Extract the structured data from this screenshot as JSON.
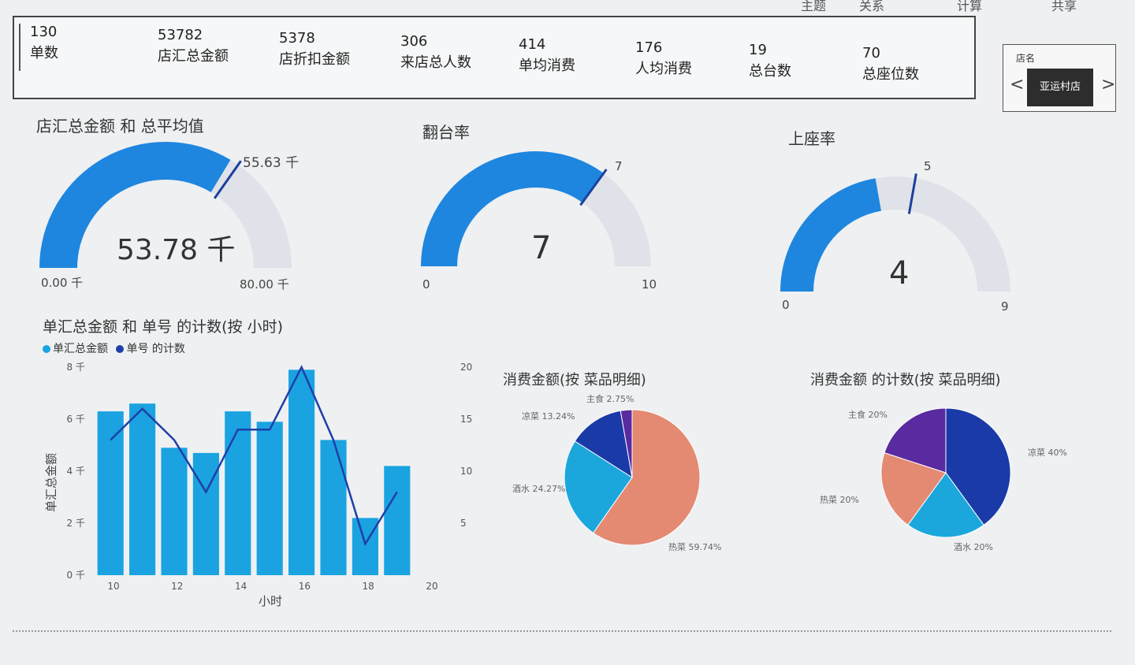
{
  "menu": [
    "主题",
    "关系",
    "计算",
    "共享"
  ],
  "kpis": [
    {
      "value": "130",
      "label": "单数"
    },
    {
      "value": "53782",
      "label": "店汇总金额"
    },
    {
      "value": "5378",
      "label": "店折扣金额"
    },
    {
      "value": "306",
      "label": "来店总人数"
    },
    {
      "value": "414",
      "label": "单均消费"
    },
    {
      "value": "176",
      "label": "人均消费"
    },
    {
      "value": "19",
      "label": "总台数"
    },
    {
      "value": "70",
      "label": "总座位数"
    }
  ],
  "slicer": {
    "title": "店名",
    "value": "亚运村店",
    "prev": "<",
    "next": ">"
  },
  "gauges": [
    {
      "title": "店汇总金额 和 总平均值",
      "value": 53.78,
      "min": 0,
      "max": 80,
      "target": 55.63,
      "value_label": "53.78 千",
      "min_label": "0.00 千",
      "max_label": "80.00 千",
      "target_label": "55.63 千"
    },
    {
      "title": "翻台率",
      "value": 7,
      "min": 0,
      "max": 10,
      "target": 7,
      "value_label": "7",
      "min_label": "0",
      "max_label": "10",
      "target_label": "7"
    },
    {
      "title": "上座率",
      "value": 4,
      "min": 0,
      "max": 9,
      "target": 5,
      "value_label": "4",
      "min_label": "0",
      "max_label": "9",
      "target_label": "5"
    }
  ],
  "combo": {
    "title": "单汇总金额 和 单号 的计数(按 小时)",
    "legend": [
      "单汇总金额",
      "单号 的计数"
    ],
    "ylabel": "单汇总金额",
    "xlabel": "小时",
    "y_ticks": [
      "0 千",
      "2 千",
      "4 千",
      "6 千",
      "8 千"
    ],
    "y2_ticks": [
      "5",
      "10",
      "15",
      "20"
    ],
    "x_ticks": [
      "10",
      "12",
      "14",
      "16",
      "18",
      "20"
    ]
  },
  "pie1": {
    "title": "消费金额(按 菜品明细)",
    "labels": [
      {
        "name": "热菜",
        "pct": "59.74%"
      },
      {
        "name": "酒水",
        "pct": "24.27%"
      },
      {
        "name": "凉菜",
        "pct": "13.24%"
      },
      {
        "name": "主食",
        "pct": "2.75%"
      }
    ]
  },
  "pie2": {
    "title": "消费金额 的计数(按 菜品明细)",
    "labels": [
      {
        "name": "凉菜",
        "pct": "40%"
      },
      {
        "name": "酒水",
        "pct": "20%"
      },
      {
        "name": "热菜",
        "pct": "20%"
      },
      {
        "name": "主食",
        "pct": "20%"
      }
    ]
  },
  "chart_data": [
    {
      "type": "bar",
      "title": "单汇总金额 和 单号 的计数(按 小时)",
      "x": [
        10,
        11,
        12,
        13,
        14,
        15,
        16,
        17,
        18,
        19
      ],
      "series": [
        {
          "name": "单汇总金额",
          "values": [
            6.3,
            6.6,
            4.9,
            4.7,
            6.3,
            5.9,
            7.9,
            5.2,
            2.2,
            4.2
          ]
        },
        {
          "name": "单号 的计数",
          "values": [
            13,
            16,
            13,
            8,
            14,
            14,
            20,
            13,
            3,
            8
          ]
        }
      ],
      "xlabel": "小时",
      "ylabel": "单汇总金额",
      "ylim": [
        0,
        8
      ],
      "y2lim": [
        5,
        20
      ]
    },
    {
      "type": "pie",
      "title": "消费金额(按 菜品明细)",
      "categories": [
        "热菜",
        "酒水",
        "凉菜",
        "主食"
      ],
      "values": [
        59.74,
        24.27,
        13.24,
        2.75
      ]
    },
    {
      "type": "pie",
      "title": "消费金额 的计数(按 菜品明细)",
      "categories": [
        "凉菜",
        "酒水",
        "热菜",
        "主食"
      ],
      "values": [
        40,
        20,
        20,
        20
      ]
    }
  ],
  "colors": {
    "blue": "#1e86df",
    "lightgray": "#dfe2e8",
    "bar": "#1aa3e0",
    "line": "#1f3fa8",
    "salmon": "#e48a73",
    "navy": "#1a3aa8",
    "cyan": "#1ca7dc",
    "purple": "#5a2aa0"
  }
}
